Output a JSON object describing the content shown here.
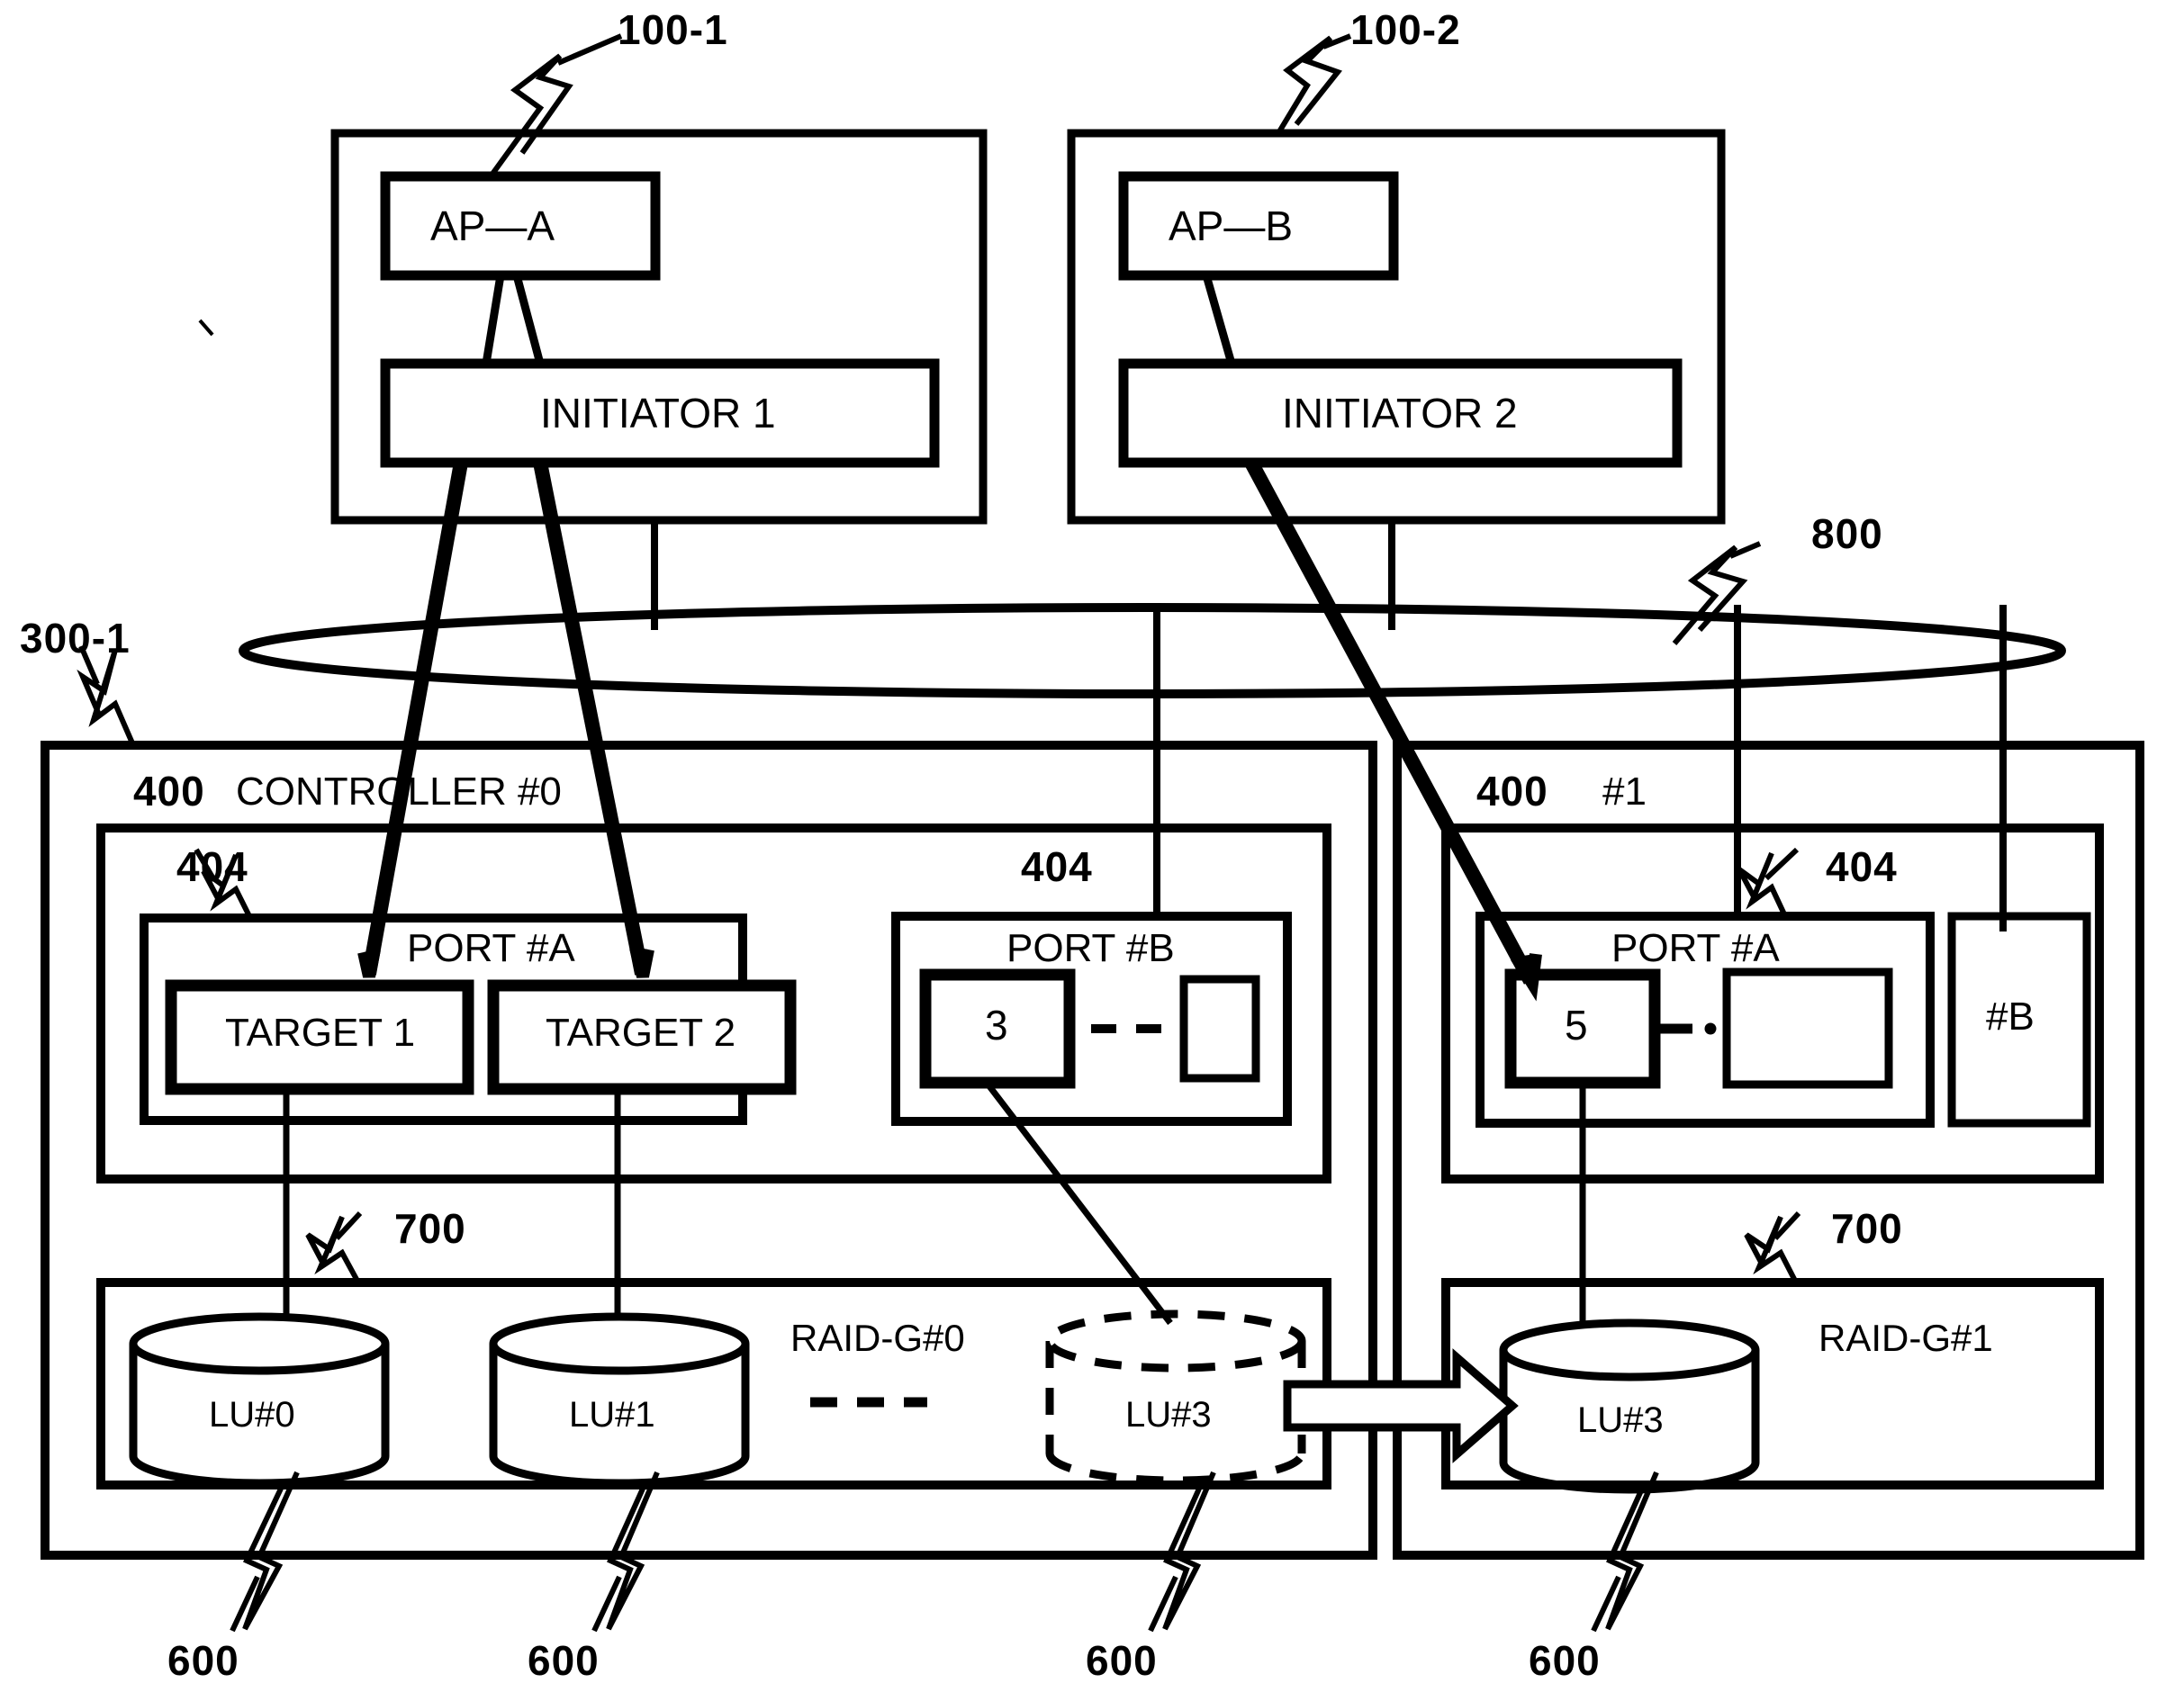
{
  "figure": {
    "type": "patent-block-diagram",
    "background": "#ffffff",
    "stroke": "#000000"
  },
  "hosts": [
    {
      "ref": "100-1",
      "app_label": "AP—A",
      "initiator_label": "INITIATOR 1"
    },
    {
      "ref": "100-2",
      "app_label": "AP—B",
      "initiator_label": "INITIATOR 2"
    }
  ],
  "network": {
    "ref": "800"
  },
  "storage": {
    "ref": "300-1",
    "controllers": [
      {
        "ref": "400",
        "name": "CONTROLLER #0",
        "ports": [
          {
            "ref": "404",
            "name": "PORT #A",
            "targets": [
              {
                "label": "TARGET 1",
                "bold": true
              },
              {
                "label": "TARGET 2",
                "bold": true
              }
            ]
          },
          {
            "ref": "404",
            "name": "PORT #B",
            "targets": [
              {
                "label": "3",
                "bold": true
              },
              {
                "label": "",
                "bold": false
              }
            ],
            "dash_connector": "- -"
          }
        ],
        "raid_group": {
          "ref": "700",
          "name": "RAID-G#0",
          "dash_marker": "- - -",
          "volumes": [
            {
              "label": "LU#0",
              "ref": "600",
              "dashed": false
            },
            {
              "label": "LU#1",
              "ref": "600",
              "dashed": false
            },
            {
              "label": "LU#3",
              "ref": "600",
              "dashed": true
            }
          ]
        }
      },
      {
        "ref": "400",
        "name": "#1",
        "ports": [
          {
            "ref": "404",
            "name": "PORT #A",
            "targets": [
              {
                "label": "5",
                "bold": true
              },
              {
                "label": "",
                "bold": false
              }
            ]
          },
          {
            "ref": "",
            "name": "#B",
            "targets": []
          }
        ],
        "raid_group": {
          "ref": "700",
          "name": "RAID-G#1",
          "volumes": [
            {
              "label": "LU#3",
              "ref": "600",
              "dashed": false
            }
          ]
        }
      }
    ]
  },
  "migration_arrow": {
    "from": "LU#3 (RAID-G#0)",
    "to": "LU#3 (RAID-G#1)"
  }
}
